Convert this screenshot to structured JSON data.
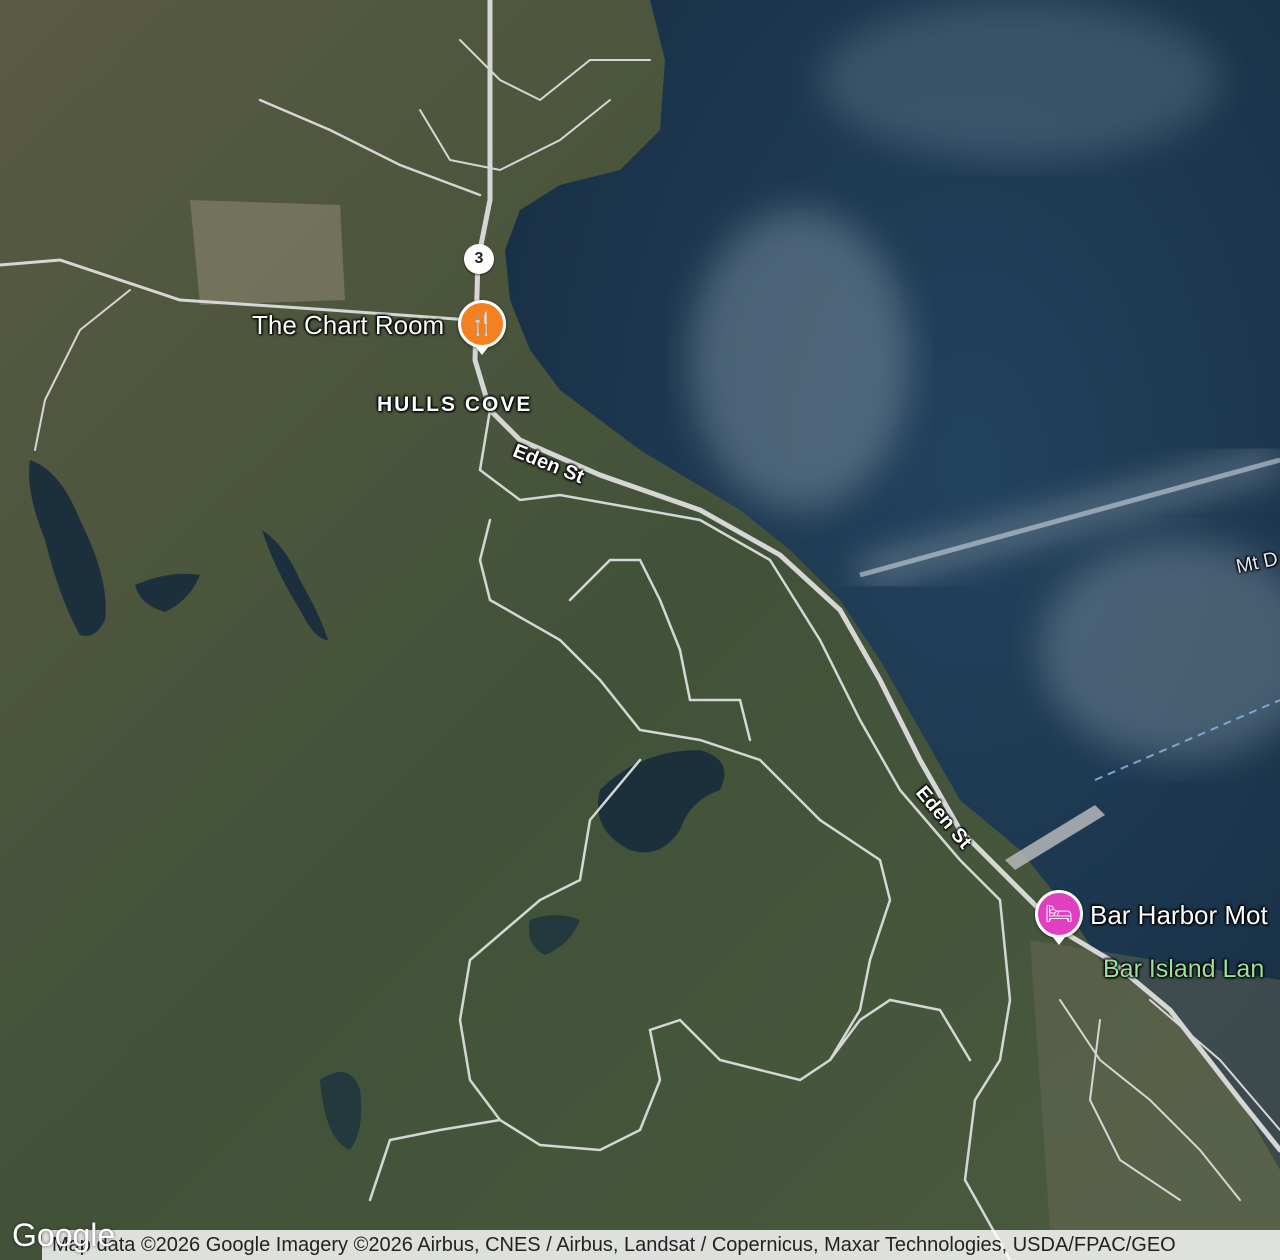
{
  "map": {
    "type": "satellite",
    "pois": [
      {
        "name": "The Chart Room",
        "icon": "restaurant-icon",
        "color": "#f48020"
      },
      {
        "name": "Bar Harbor Mot",
        "icon": "hotel-bed-icon",
        "color": "#e040c0"
      }
    ],
    "area_label": "HULLS COVE",
    "road_labels": [
      "Eden St",
      "Eden St"
    ],
    "route_shield": "3",
    "green_label": "Bar Island Lan",
    "water_label": "Mt D",
    "attribution": "Map data ©2026 Google Imagery ©2026 Airbus, CNES / Airbus, Landsat / Copernicus, Maxar Technologies, USDA/FPAC/GEO",
    "logo": "Google",
    "colors": {
      "water": "#1c3a52",
      "land": "#4a5a3e",
      "road": "#d9d9d9"
    }
  }
}
